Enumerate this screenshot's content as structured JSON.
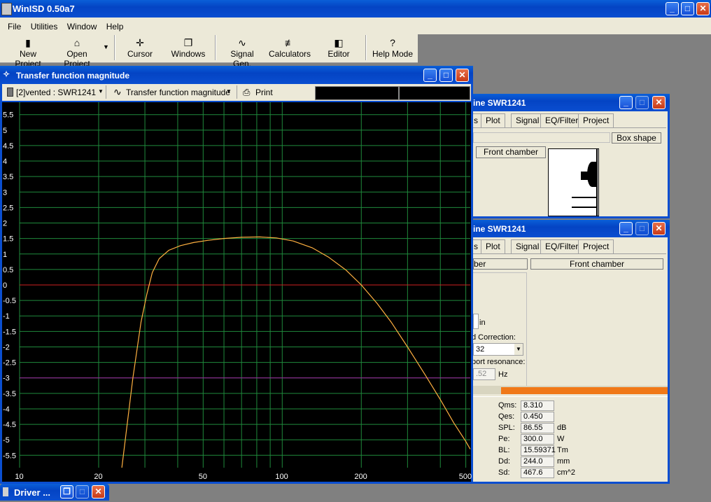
{
  "app": {
    "title": "WinISD 0.50a7"
  },
  "menu": [
    "File",
    "Utilities",
    "Window",
    "Help"
  ],
  "toolbar": {
    "new_project": "New Project",
    "open_project": "Open Project",
    "cursor": "Cursor",
    "windows": "Windows",
    "signal_gen": "Signal Gen.",
    "calculators": "Calculators",
    "editor": "Editor",
    "help_mode": "Help Mode"
  },
  "plot_window": {
    "title": "Transfer function magnitude",
    "project_select": "[2]vented : SWR1241",
    "graph_select": "Transfer function magnitude",
    "print": "Print",
    "y_ticks": [
      "5.5",
      "5",
      "4.5",
      "4",
      "3.5",
      "3",
      "2.5",
      "2",
      "1.5",
      "1",
      "0.5",
      "0",
      "-0.5",
      "-1",
      "-1.5",
      "-2",
      "-2.5",
      "-3",
      "-3.5",
      "-4",
      "-4.5",
      "-5",
      "-5.5"
    ],
    "x_ticks": [
      "10",
      "20",
      "50",
      "100",
      "200",
      "500"
    ]
  },
  "chart_data": {
    "type": "line",
    "title": "Transfer function magnitude",
    "xlabel": "",
    "ylabel": "",
    "x_scale": "log",
    "xlim": [
      10,
      520
    ],
    "ylim": [
      -5.9,
      5.9
    ],
    "grid": true,
    "reference_lines": [
      {
        "y": 0,
        "color": "#d02020"
      },
      {
        "y": -3,
        "color": "#a020a0"
      }
    ],
    "series": [
      {
        "color": "#ffb040",
        "x": [
          24.5,
          27,
          29,
          30.5,
          32,
          34,
          37,
          41,
          46,
          52,
          60,
          70,
          82,
          95,
          110,
          130,
          150,
          175,
          200,
          230,
          260,
          300,
          350,
          400,
          450,
          500,
          520
        ],
        "y": [
          -5.9,
          -3.0,
          -1.2,
          -0.3,
          0.4,
          0.85,
          1.12,
          1.27,
          1.37,
          1.44,
          1.5,
          1.54,
          1.55,
          1.52,
          1.42,
          1.2,
          0.9,
          0.48,
          0.0,
          -0.6,
          -1.2,
          -2.0,
          -2.9,
          -3.7,
          -4.45,
          -5.05,
          -5.3
        ]
      }
    ]
  },
  "machine_window_1": {
    "title": "ine SWR1241",
    "tabs": [
      "s",
      "Plot",
      "Signal",
      "EQ/Filter",
      "Project"
    ],
    "box_shape": "Box shape",
    "front_chamber": "Front chamber"
  },
  "machine_window_2": {
    "title": "ine SWR1241",
    "tabs": [
      "s",
      "Plot",
      "Signal",
      "EQ/Filter",
      "Project"
    ],
    "chamber_label": "ber",
    "front_chamber": "Front chamber",
    "unit_in": "in",
    "correction_label": "d Correction:",
    "correction_value": "32",
    "port_resonance_label": "port resonance:",
    "port_resonance_value": ".52",
    "port_resonance_unit": "Hz"
  },
  "driver_params": [
    {
      "label": "Qms:",
      "value": "8.310",
      "unit": ""
    },
    {
      "label": "Qes:",
      "value": "0.450",
      "unit": ""
    },
    {
      "label": "SPL:",
      "value": "86.55",
      "unit": "dB"
    },
    {
      "label": "Pe:",
      "value": "300.0",
      "unit": "W"
    },
    {
      "label": "BL:",
      "value": "15.59371",
      "unit": "Tm"
    },
    {
      "label": "Dd:",
      "value": "244.0",
      "unit": "mm"
    },
    {
      "label": "Sd:",
      "value": "467.6",
      "unit": "cm^2"
    }
  ],
  "minimized": {
    "driver_title": "Driver ..."
  }
}
